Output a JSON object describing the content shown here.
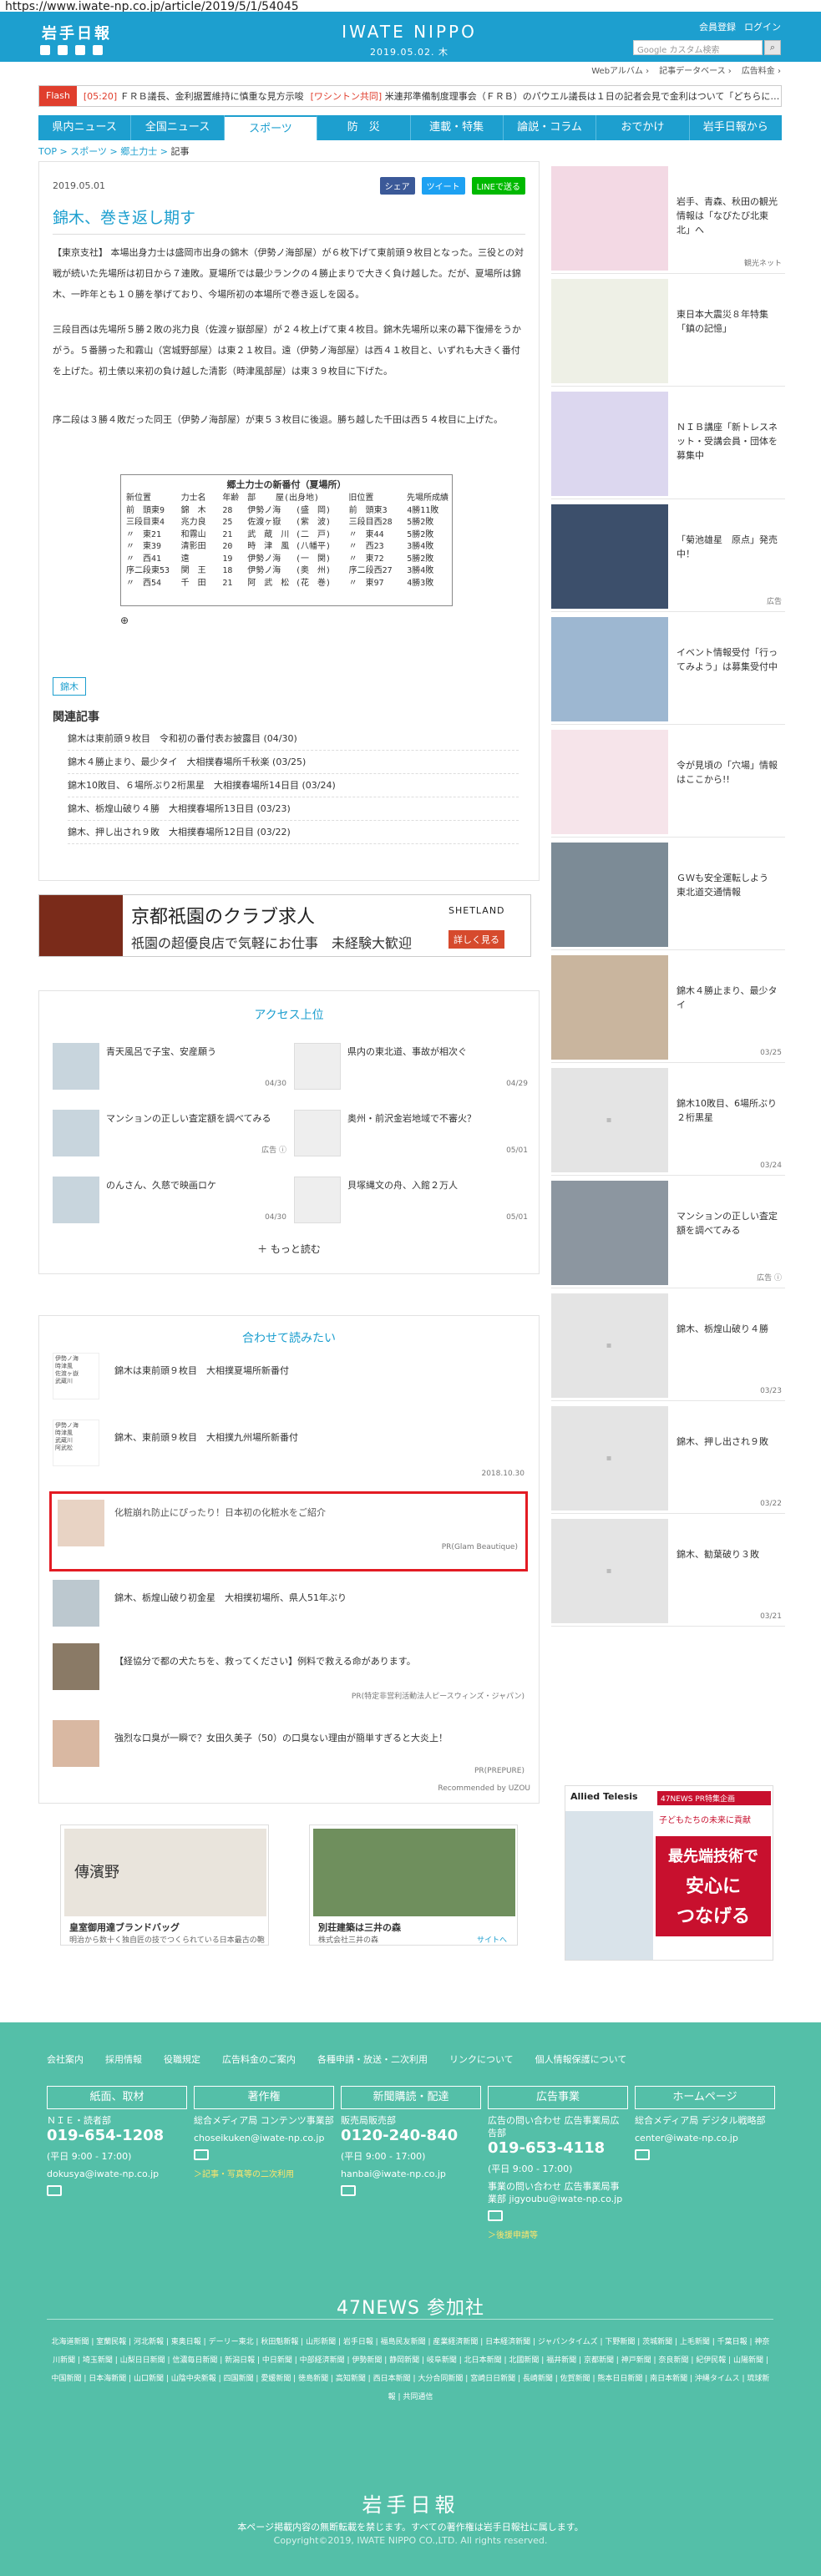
{
  "browser": {
    "url": "https://www.iwate-np.co.jp/article/2019/5/1/54045"
  },
  "header": {
    "logo_jp": "岩手日報",
    "logo_en": "IWATE NIPPO",
    "date": "2019.05.02. 木",
    "member_register": "会員登録",
    "login": "ログイン",
    "search_placeholder": "Google カスタム検索",
    "sub_links": [
      "Webアルバム ›",
      "記事データベース ›",
      "広告料金 ›"
    ]
  },
  "flash": {
    "label": "Flash",
    "items": [
      {
        "time": "[05:20]",
        "text": "ＦＲＢ議長、金利据置維持に慎重な見方示唆"
      },
      {
        "time": "[ワシントン共同]",
        "text": "米連邦準備制度理事会（ＦＲＢ）のパウエル議長は１日の記者会見で金利はついて「どちらに…"
      }
    ]
  },
  "nav": [
    "県内ニュース",
    "全国ニュース",
    "スポーツ",
    "防　災",
    "連載・特集",
    "論説・コラム",
    "おでかけ",
    "岩手日報から"
  ],
  "nav_active": "スポーツ",
  "breadcrumb": {
    "a": "TOP",
    "b": "スポーツ",
    "c": "郷土力士",
    "d": "記事"
  },
  "article": {
    "date": "2019.05.01",
    "share": [
      "シェア",
      "ツイート",
      "LINEで送る"
    ],
    "title": "錦木、巻き返し期す",
    "paragraphs": [
      "【東京支社】 本場出身力士は盛岡市出身の錦木（伊勢ノ海部屋）が６枚下げて東前頭９枚目となった。三役との対戦が続いた先場所は初日から７連敗。夏場所では最少ランクの４勝止まりで大きく負け越した。だが、夏場所は錦木、一昨年とも１０勝を挙げており、今場所初の本場所で巻き返しを図る。",
      "三段目西は先場所５勝２敗の兆力良（佐渡ヶ嶽部屋）が２４枚上げて東４枚目。錦木先場所以来の幕下復帰をうかがう。５番勝った和霧山（宮城野部屋）は東２１枚目。遠（伊勢ノ海部屋）は西４１枚目と、いずれも大きく番付を上げた。初土俵以来初の負け越した清影（時津風部屋）は東３９枚目に下げた。",
      "序二段は３勝４敗だった同王（伊勢ノ海部屋）が東５３枚目に後退。勝ち越した千田は西５４枚目に上げた。"
    ],
    "table_title": "郷土力士の新番付（夏場所）",
    "table_header": [
      "新位置",
      "力士名",
      "年齢",
      "部",
      "屋",
      "(出身地)",
      "旧位置",
      "先場所成績"
    ],
    "table_rows": [
      [
        "前　頭東9",
        "錦　木",
        "28",
        "伊勢ノ海",
        "(盛　岡)",
        "前　頭東3",
        "4勝11敗"
      ],
      [
        "三段目東4",
        "兆力良",
        "25",
        "佐渡ヶ嶽",
        "(紫　波)",
        "三段目西28",
        "5勝2敗"
      ],
      [
        "〃　東21",
        "和霧山",
        "21",
        "武　蔵　川",
        "(二　戸)",
        "〃　東44",
        "5勝2敗"
      ],
      [
        "〃　東39",
        "清影田",
        "20",
        "時　津　風",
        "(八幡平)",
        "〃　西23",
        "3勝4敗"
      ],
      [
        "〃　西41",
        "遠",
        "19",
        "伊勢ノ海",
        "(一　関)",
        "〃　東72",
        "5勝2敗"
      ],
      [
        "序二段東53",
        "関　王",
        "18",
        "伊勢ノ海",
        "(奥　州)",
        "序二段西27",
        "3勝4敗"
      ],
      [
        "〃　西54",
        "千　田",
        "21",
        "阿　武　松",
        "(花　巻)",
        "〃　東97",
        "4勝3敗"
      ]
    ],
    "tag": "錦木",
    "related_title": "関連記事",
    "related": [
      "錦木は東前頭９枚目　令和初の番付表お披露目 (04/30)",
      "錦木４勝止まり、最少タイ　大相撲春場所千秋楽 (03/25)",
      "錦木10敗目、６場所ぶり2桁黒星　大相撲春場所14日目 (03/24)",
      "錦木、栃煌山破り４勝　大相撲春場所13日目 (03/23)",
      "錦木、押し出され９敗　大相撲春場所12日目 (03/22)"
    ]
  },
  "ad_banner": {
    "title": "京都祇園のクラブ求人",
    "text": "祇園の超優良店で気軽にお仕事　未経験大歓迎",
    "brand": "SHETLAND",
    "button": "詳しく見る"
  },
  "access": {
    "title": "アクセス上位",
    "items": [
      {
        "text": "青天風呂で子宝、安産願う",
        "date": "04/30"
      },
      {
        "text": "県内の東北道、事故が相次ぐ",
        "date": "04/29"
      },
      {
        "text": "マンションの正しい査定額を調べてみる",
        "date": "広告 ⓘ"
      },
      {
        "text": "奥州・前沢金岩地域で不審火？",
        "date": "05/01"
      },
      {
        "text": "のんさん、久慈で映画ロケ",
        "date": "04/30"
      },
      {
        "text": "貝塚縄文の舟、入館２万人",
        "date": "05/01"
      }
    ],
    "more": "もっと読む"
  },
  "recommend": {
    "title": "合わせて読みたい",
    "items": [
      {
        "text": "錦木は東前頭９枚目　大相撲夏場所新番付",
        "sponsor": ""
      },
      {
        "text": "錦木、東前頭９枚目　大相撲九州場所新番付",
        "sponsor": "2018.10.30"
      },
      {
        "text": "化粧崩れ防止にぴったり！日本初の化粧水をご紹介",
        "sponsor": "PR(Glam Beautique)"
      },
      {
        "text": "錦木、栃煌山破り初金星　大相撲初場所、県人51年ぶり",
        "sponsor": ""
      },
      {
        "text": "【経協分で都の犬たちを、救ってください】例料で救える命があります。",
        "sponsor": "PR(特定非営利活動法人ピースウィンズ・ジャパン)"
      },
      {
        "text": "強烈な口臭が一瞬で？女田久美子（50）の口臭ない理由が簡単すぎると大炎上！",
        "sponsor": "PR(PREPURE)"
      }
    ],
    "powered": "Recommended by UZOU"
  },
  "ads_bottom": [
    {
      "title": "皇室御用達ブランドバッグ",
      "text": "明治から数十く独自匠の技でつくられている日本最古の鞄",
      "logo": "傳濱野"
    },
    {
      "title": "別荘建築は三井の森",
      "text": "株式会社三井の森",
      "link": "サイトへ"
    }
  ],
  "sidebar": [
    {
      "text": "岩手、青森、秋田の観光情報は「なびたび北東北」へ",
      "date": "観光ネット"
    },
    {
      "text": "東日本大震災８年特集「鎮の記憶」",
      "date": ""
    },
    {
      "text": "ＮＩＢ講座「新トレスネット・受講会員・団体を募集中",
      "date": ""
    },
    {
      "text": "「菊池雄星　原点」発売中！",
      "date": "広告"
    },
    {
      "text": "イベント情報受付「行ってみよう」は募集受付中",
      "date": ""
    },
    {
      "text": "令が見頃の「穴場」情報はここから!!",
      "date": ""
    },
    {
      "text": "ＧＷも安全運転しよう　東北道交通情報",
      "date": ""
    },
    {
      "text": "錦木４勝止まり、最少タイ",
      "date": "03/25"
    },
    {
      "text": "錦木10敗目、6場所ぶり２桁黒星",
      "date": "03/24"
    },
    {
      "text": "マンションの正しい査定額を調べてみる",
      "date": "広告 ⓘ"
    },
    {
      "text": "錦木、栃煌山破り４勝",
      "date": "03/23"
    },
    {
      "text": "錦木、押し出され９敗",
      "date": "03/22"
    },
    {
      "text": "錦木、勧葉破り３敗",
      "date": "03/21"
    }
  ],
  "side_ad": {
    "brand": "Allied Telesis",
    "sub": "47NEWS PR特集企画",
    "line1": "子どもたちの未来に貢献",
    "line2": "最先端技術で",
    "line3": "安心に",
    "line4": "つなげる"
  },
  "footer": {
    "links": [
      "会社案内",
      "採用情報",
      "役職規定",
      "広告料金のご案内",
      "各種申請・放送・二次利用",
      "リンクについて",
      "個人情報保護について"
    ],
    "cols": [
      {
        "h": "紙面、取材",
        "t1": "ＮＩＥ・読者部",
        "phone": "019-654-1208",
        "t2": "(平日 9:00 - 17:00)",
        "t3": "dokusya@iwate-np.co.jp",
        "y": ""
      },
      {
        "h": "著作権",
        "t1": "総合メディア局 コンテンツ事業部",
        "phone": "",
        "t2": "",
        "t3": "choseikuken@iwate-np.co.jp",
        "y": "＞記事・写真等の二次利用"
      },
      {
        "h": "新聞購読・配達",
        "t1": "販売局販売部",
        "phone": "0120-240-840",
        "t2": "(平日 9:00 - 17:00)",
        "t3": "hanbai@iwate-np.co.jp",
        "y": ""
      },
      {
        "h": "広告事業",
        "t1": "広告の問い合わせ 広告事業局広告部",
        "phone": "019-653-4118",
        "t2": "(平日 9:00 - 17:00)",
        "t3": "事業の問い合わせ 広告事業局事業部 jigyoubu@iwate-np.co.jp",
        "y": "＞後援申請等"
      },
      {
        "h": "ホームページ",
        "t1": "総合メディア局 デジタル戦略部",
        "phone": "",
        "t2": "",
        "t3": "center@iwate-np.co.jp",
        "y": ""
      }
    ],
    "n47": "47NEWS 参加社",
    "papers": "北海道新聞 | 室蘭民報 | 河北新報 | 東奥日報 | デーリー東北 | 秋田魁新報 | 山形新聞 | 岩手日報 | 福島民友新聞 | 産業経済新聞 | 日本経済新聞 | ジャパンタイムズ | 下野新聞 | 茨城新聞 | 上毛新聞 | 千葉日報 | 神奈川新聞 | 埼玉新聞 | 山梨日日新聞 | 信濃毎日新聞 | 新潟日報 | 中日新聞 | 中部経済新聞 | 伊勢新聞 | 静岡新聞 | 岐阜新聞 | 北日本新聞 | 北國新聞 | 福井新聞 | 京都新聞 | 神戸新聞 | 奈良新聞 | 紀伊民報 | 山陽新聞 | 中国新聞 | 日本海新聞 | 山口新聞 | 山陰中央新報 | 四国新聞 | 愛媛新聞 | 徳島新聞 | 高知新聞 | 西日本新聞 | 大分合同新聞 | 宮崎日日新聞 | 長崎新聞 | 佐賀新聞 | 熊本日日新聞 | 南日本新聞 | 沖縄タイムス | 琉球新報 | 共同通信",
    "logo": "岩手日報",
    "c1": "本ページ掲載内容の無断転載を禁じます。すべての著作権は岩手日報社に属します。",
    "c2": "Copyright©2019, IWATE NIPPO CO.,LTD. All rights reserved."
  }
}
